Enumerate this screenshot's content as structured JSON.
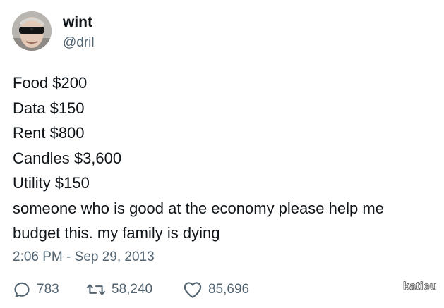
{
  "author": {
    "display_name": "wint",
    "handle": "@dril"
  },
  "tweet": {
    "lines": [
      "Food $200",
      "Data $150",
      "Rent $800",
      "Candles $3,600",
      "Utility $150",
      "someone who is good at the economy please help me",
      "budget this. my family is dying"
    ],
    "timestamp": "2:06 PM - Sep 29, 2013"
  },
  "actions": {
    "replies": {
      "count": "783",
      "icon": "reply-icon"
    },
    "retweets": {
      "count": "58,240",
      "icon": "retweet-icon"
    },
    "likes": {
      "count": "85,696",
      "icon": "heart-icon"
    }
  },
  "watermark": "katieu",
  "colors": {
    "text": "#0f1419",
    "secondary": "#536471",
    "background": "#ffffff"
  }
}
